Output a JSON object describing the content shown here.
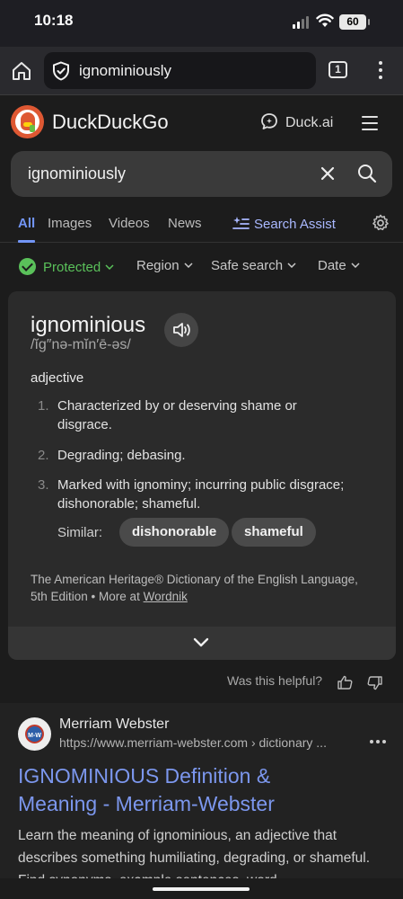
{
  "status": {
    "time": "10:18",
    "battery": "60"
  },
  "browser": {
    "url": "ignominiously",
    "tab_count": "1"
  },
  "header": {
    "brand": "DuckDuckGo",
    "duckai_label": "Duck.ai"
  },
  "search": {
    "query": "ignominiously"
  },
  "nav": {
    "tabs": [
      {
        "label": "All",
        "active": true
      },
      {
        "label": "Images"
      },
      {
        "label": "Videos"
      },
      {
        "label": "News"
      }
    ],
    "assist_label": "Search Assist"
  },
  "filters": {
    "protected": "Protected",
    "region": "Region",
    "safe_search": "Safe search",
    "date": "Date"
  },
  "definition": {
    "word": "ignominious",
    "pronunciation": "/ĭg″nə-mĭn′ē-əs/",
    "part_of_speech": "adjective",
    "senses": [
      {
        "num": "1.",
        "text": "Characterized by or deserving shame or disgrace."
      },
      {
        "num": "2.",
        "text": "Degrading; debasing."
      },
      {
        "num": "3.",
        "text": "Marked with ignominy; incurring public disgrace; dishonorable; shameful."
      }
    ],
    "similar_label": "Similar:",
    "similar": [
      "dishonorable",
      "shameful"
    ],
    "source_text": "The American Heritage® Dictionary of the English Language, 5th Edition •",
    "more_at": "More at",
    "more_link": "Wordnik"
  },
  "feedback": {
    "question": "Was this helpful?"
  },
  "result": {
    "site_name": "Merriam Webster",
    "favicon_text": "M-W",
    "url": "https://www.merriam-webster.com › dictionary ...",
    "title": "IGNOMINIOUS Definition & Meaning - Merriam-Webster",
    "snippet": "Learn the meaning of ignominious, an adjective that describes something humiliating, degrading, or shameful. Find synonyms, example sentences, word"
  },
  "colors": {
    "accent": "#7295f6",
    "protected_green": "#5ac15a",
    "brand_orange": "#de5833",
    "result_title": "#7c97ee"
  }
}
